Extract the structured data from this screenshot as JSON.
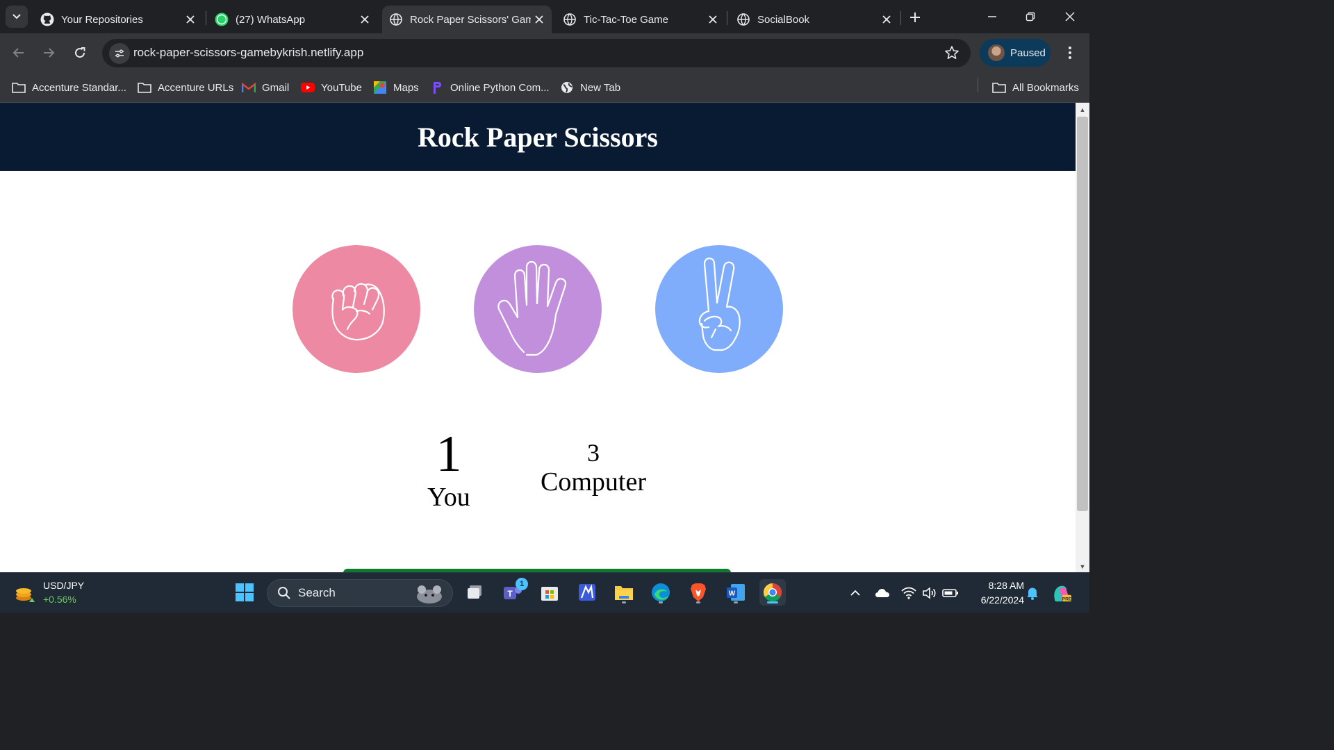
{
  "browser": {
    "tabs": [
      {
        "title": "Your Repositories",
        "favicon": "github-icon",
        "active": false
      },
      {
        "title": "(27) WhatsApp",
        "favicon": "whatsapp-icon",
        "badge": "27",
        "active": false
      },
      {
        "title": "Rock Paper Scissors' Gam",
        "favicon": "globe-icon",
        "active": true
      },
      {
        "title": "Tic-Tac-Toe Game",
        "favicon": "globe-icon",
        "active": false
      },
      {
        "title": "SocialBook",
        "favicon": "globe-icon",
        "active": false
      }
    ],
    "url": "rock-paper-scissors-gamebykrish.netlify.app",
    "profile_label": "Paused",
    "bookmarks": [
      {
        "label": "Accenture Standar...",
        "icon": "folder-icon"
      },
      {
        "label": "Accenture URLs",
        "icon": "folder-icon"
      },
      {
        "label": "Gmail",
        "icon": "gmail-icon"
      },
      {
        "label": "YouTube",
        "icon": "youtube-icon"
      },
      {
        "label": "Maps",
        "icon": "maps-icon"
      },
      {
        "label": "Online Python Com...",
        "icon": "python-compiler-icon"
      },
      {
        "label": "New Tab",
        "icon": "globe-icon"
      }
    ],
    "all_bookmarks_label": "All Bookmarks"
  },
  "page": {
    "title": "Rock Paper Scissors",
    "choices": [
      {
        "name": "rock",
        "color": "#ee89a4"
      },
      {
        "name": "paper",
        "color": "#c28fdd"
      },
      {
        "name": "scissors",
        "color": "#80acfc"
      }
    ],
    "score": {
      "user_score": "1",
      "user_label": "You",
      "computer_score": "3",
      "computer_label": "Computer"
    },
    "header_color": "#081b33",
    "message_bar_color": "#0c7a2a"
  },
  "taskbar": {
    "widget": {
      "title": "USD/JPY",
      "change": "+0.56%"
    },
    "search_label": "Search",
    "teams_badge": "1",
    "time": "8:28 AM",
    "date": "6/22/2024"
  }
}
